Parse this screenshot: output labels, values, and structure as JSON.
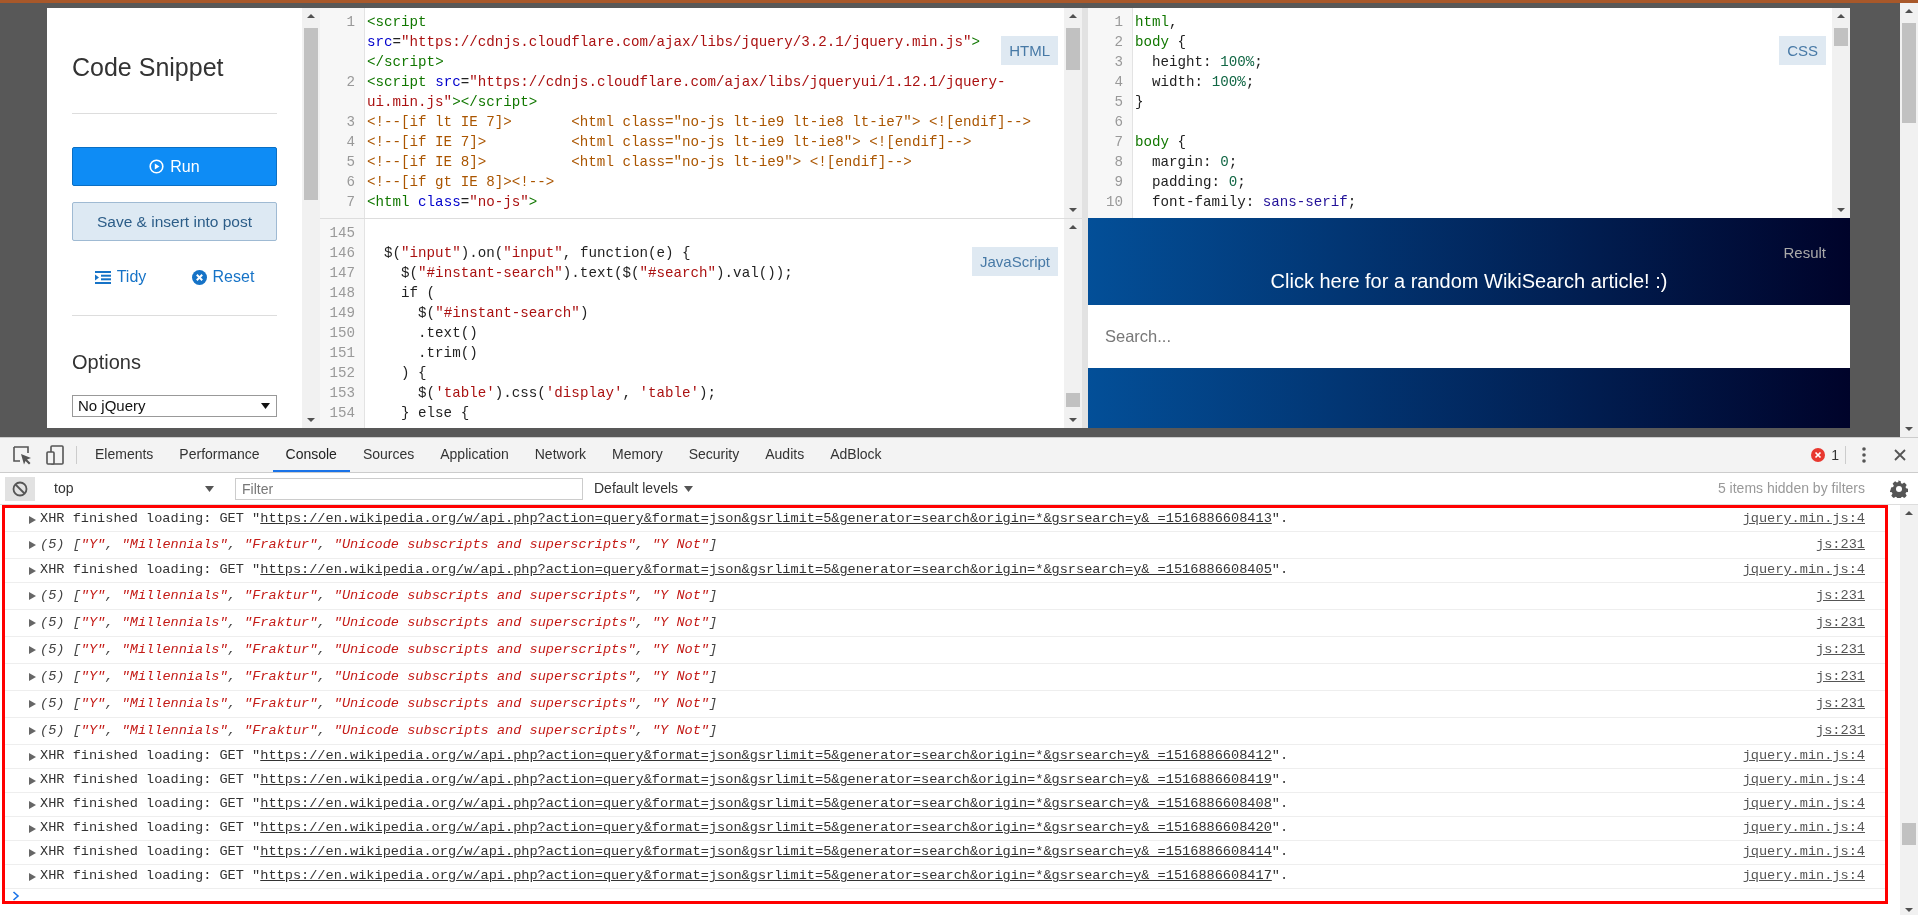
{
  "sidebar": {
    "title": "Code Snippet",
    "run_button": "Run",
    "save_button": "Save & insert into post",
    "tidy_link": "Tidy",
    "reset_link": "Reset",
    "options_heading": "Options",
    "library_select": "No jQuery"
  },
  "editors": [
    {
      "kind": "html",
      "label": "HTML",
      "lines": [
        {
          "number": "1",
          "rows": [
            "<script",
            "src=\"https://cdnjs.cloudflare.com/ajax/libs/jquery/3.2.1/jquery.min.js\">",
            "</script>"
          ]
        },
        {
          "number": "2",
          "rows": [
            "<script src=\"https://cdnjs.cloudflare.com/ajax/libs/jqueryui/1.12.1/jquery-",
            "ui.min.js\"></script>"
          ]
        },
        {
          "number": "3",
          "rows": [
            "<!--[if lt IE 7]>       <html class=\"no-js lt-ie9 lt-ie8 lt-ie7\"> <![endif]-->"
          ]
        },
        {
          "number": "4",
          "rows": [
            "<!--[if IE 7]>          <html class=\"no-js lt-ie9 lt-ie8\"> <![endif]-->"
          ]
        },
        {
          "number": "5",
          "rows": [
            "<!--[if IE 8]>          <html class=\"no-js lt-ie9\"> <![endif]-->"
          ]
        },
        {
          "number": "6",
          "rows": [
            "<!--[if gt IE 8]><!-->"
          ]
        },
        {
          "number": "7",
          "rows": [
            "<html class=\"no-js\">"
          ]
        }
      ]
    },
    {
      "kind": "javascript",
      "label": "JavaScript",
      "lines": [
        {
          "number": "145"
        },
        {
          "number": "146",
          "rows": [
            "  $(\"input\").on(\"input\", function(e) {"
          ]
        },
        {
          "number": "147",
          "rows": [
            "    $(\"#instant-search\").text($(\"#search\").val());"
          ]
        },
        {
          "number": "148",
          "rows": [
            "    if ("
          ]
        },
        {
          "number": "149",
          "rows": [
            "      $(\"#instant-search\")"
          ]
        },
        {
          "number": "150",
          "rows": [
            "      .text()"
          ]
        },
        {
          "number": "151",
          "rows": [
            "      .trim()"
          ]
        },
        {
          "number": "152",
          "rows": [
            "    ) {"
          ]
        },
        {
          "number": "153",
          "rows": [
            "      $('table').css('display', 'table');"
          ]
        },
        {
          "number": "154",
          "rows": [
            "    } else {"
          ]
        }
      ]
    },
    {
      "kind": "css",
      "label": "CSS",
      "lines": [
        {
          "number": "1",
          "rows": [
            "html,"
          ]
        },
        {
          "number": "2",
          "rows": [
            "body {"
          ]
        },
        {
          "number": "3",
          "rows": [
            "  height: 100%;"
          ]
        },
        {
          "number": "4",
          "rows": [
            "  width: 100%;"
          ]
        },
        {
          "number": "5",
          "rows": [
            "}"
          ]
        },
        {
          "number": "6"
        },
        {
          "number": "7",
          "rows": [
            "body {"
          ]
        },
        {
          "number": "8",
          "rows": [
            "  margin: 0;"
          ]
        },
        {
          "number": "9",
          "rows": [
            "  padding: 0;"
          ]
        },
        {
          "number": "10",
          "rows": [
            "  font-family: sans-serif;"
          ]
        }
      ]
    }
  ],
  "result": {
    "label": "Result",
    "banner_link": "Click here for a random WikiSearch article! :)",
    "search_placeholder": "Search..."
  },
  "devtools": {
    "tabs": [
      {
        "label": "Elements",
        "selected": false
      },
      {
        "label": "Performance",
        "selected": false
      },
      {
        "label": "Console",
        "selected": true
      },
      {
        "label": "Sources",
        "selected": false
      },
      {
        "label": "Application",
        "selected": false
      },
      {
        "label": "Network",
        "selected": false
      },
      {
        "label": "Memory",
        "selected": false
      },
      {
        "label": "Security",
        "selected": false
      },
      {
        "label": "Audits",
        "selected": false
      },
      {
        "label": "AdBlock",
        "selected": false
      }
    ],
    "error_count": "1",
    "context": "top",
    "filter_placeholder": "Filter",
    "levels": "Default levels",
    "hidden_note": "5 items hidden by filters",
    "messages": [
      {
        "kind": "xhr",
        "prefix": "XHR finished loading: GET \"",
        "url": "https://en.wikipedia.org/w/api.php?action=query&format=json&gsrlimit=5&generator=search&origin=*&gsrsearch=y&_=1516886608413",
        "suffix": "\".",
        "source": "jquery.min.js:4"
      },
      {
        "kind": "log",
        "text": "(5) [\"Y\", \"Millennials\", \"Fraktur\", \"Unicode subscripts and superscripts\", \"Y Not\"]",
        "source": "js:231"
      },
      {
        "kind": "xhr",
        "prefix": "XHR finished loading: GET \"",
        "url": "https://en.wikipedia.org/w/api.php?action=query&format=json&gsrlimit=5&generator=search&origin=*&gsrsearch=y&_=1516886608405",
        "suffix": "\".",
        "source": "jquery.min.js:4"
      },
      {
        "kind": "log",
        "text": "(5) [\"Y\", \"Millennials\", \"Fraktur\", \"Unicode subscripts and superscripts\", \"Y Not\"]",
        "source": "js:231"
      },
      {
        "kind": "log",
        "text": "(5) [\"Y\", \"Millennials\", \"Fraktur\", \"Unicode subscripts and superscripts\", \"Y Not\"]",
        "source": "js:231"
      },
      {
        "kind": "log",
        "text": "(5) [\"Y\", \"Millennials\", \"Fraktur\", \"Unicode subscripts and superscripts\", \"Y Not\"]",
        "source": "js:231"
      },
      {
        "kind": "log",
        "text": "(5) [\"Y\", \"Millennials\", \"Fraktur\", \"Unicode subscripts and superscripts\", \"Y Not\"]",
        "source": "js:231"
      },
      {
        "kind": "log",
        "text": "(5) [\"Y\", \"Millennials\", \"Fraktur\", \"Unicode subscripts and superscripts\", \"Y Not\"]",
        "source": "js:231"
      },
      {
        "kind": "log",
        "text": "(5) [\"Y\", \"Millennials\", \"Fraktur\", \"Unicode subscripts and superscripts\", \"Y Not\"]",
        "source": "js:231"
      },
      {
        "kind": "xhr",
        "prefix": "XHR finished loading: GET \"",
        "url": "https://en.wikipedia.org/w/api.php?action=query&format=json&gsrlimit=5&generator=search&origin=*&gsrsearch=y&_=1516886608412",
        "suffix": "\".",
        "source": "jquery.min.js:4"
      },
      {
        "kind": "xhr",
        "prefix": "XHR finished loading: GET \"",
        "url": "https://en.wikipedia.org/w/api.php?action=query&format=json&gsrlimit=5&generator=search&origin=*&gsrsearch=y&_=1516886608419",
        "suffix": "\".",
        "source": "jquery.min.js:4"
      },
      {
        "kind": "xhr",
        "prefix": "XHR finished loading: GET \"",
        "url": "https://en.wikipedia.org/w/api.php?action=query&format=json&gsrlimit=5&generator=search&origin=*&gsrsearch=y&_=1516886608408",
        "suffix": "\".",
        "source": "jquery.min.js:4"
      },
      {
        "kind": "xhr",
        "prefix": "XHR finished loading: GET \"",
        "url": "https://en.wikipedia.org/w/api.php?action=query&format=json&gsrlimit=5&generator=search&origin=*&gsrsearch=y&_=1516886608420",
        "suffix": "\".",
        "source": "jquery.min.js:4"
      },
      {
        "kind": "xhr",
        "prefix": "XHR finished loading: GET \"",
        "url": "https://en.wikipedia.org/w/api.php?action=query&format=json&gsrlimit=5&generator=search&origin=*&gsrsearch=y&_=1516886608414",
        "suffix": "\".",
        "source": "jquery.min.js:4"
      },
      {
        "kind": "xhr",
        "prefix": "XHR finished loading: GET \"",
        "url": "https://en.wikipedia.org/w/api.php?action=query&format=json&gsrlimit=5&generator=search&origin=*&gsrsearch=y&_=1516886608417",
        "suffix": "\".",
        "source": "jquery.min.js:4"
      }
    ]
  }
}
